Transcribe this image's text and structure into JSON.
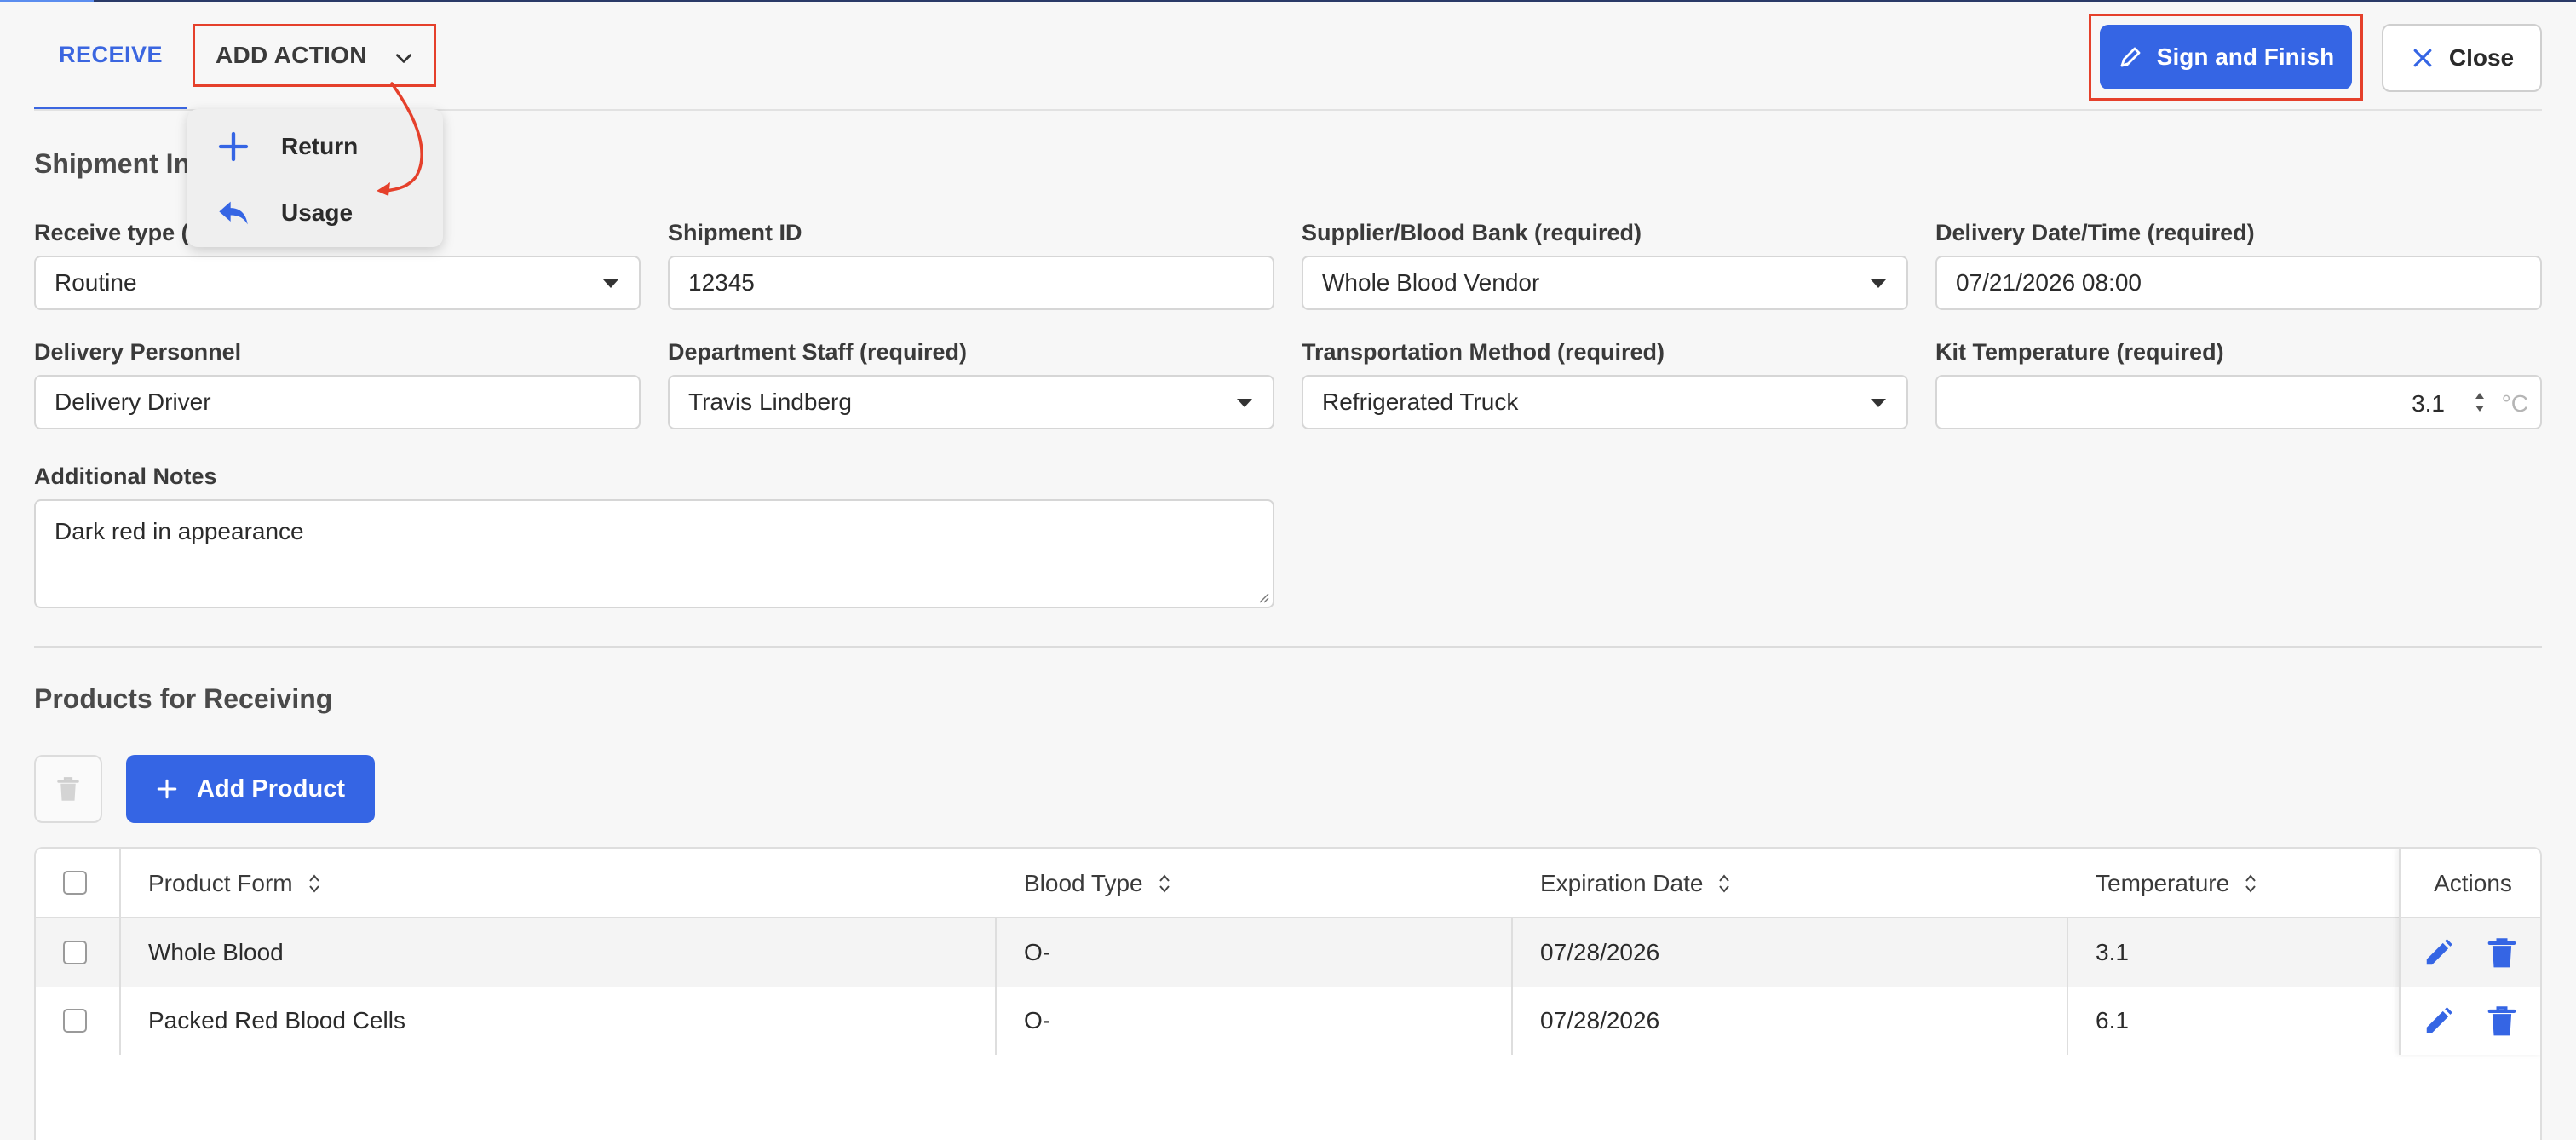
{
  "header": {
    "tab_receive": "RECEIVE",
    "add_action_label": "ADD ACTION",
    "sign_finish_label": "Sign and Finish",
    "close_label": "Close"
  },
  "menu": {
    "items": [
      {
        "label": "Return",
        "icon": "plus-icon"
      },
      {
        "label": "Usage",
        "icon": "reply-arrow-icon"
      }
    ]
  },
  "shipment": {
    "title_visible": "Shipment In",
    "receive_type": {
      "label_visible": "Receive type (r",
      "value": "Routine"
    },
    "shipment_id": {
      "label": "Shipment ID",
      "value": "12345"
    },
    "supplier": {
      "label": "Supplier/Blood Bank (required)",
      "value": "Whole Blood Vendor"
    },
    "delivery_date": {
      "label": "Delivery Date/Time (required)",
      "value": "07/21/2026 08:00"
    },
    "delivery_personnel": {
      "label": "Delivery Personnel",
      "value": "Delivery Driver"
    },
    "department_staff": {
      "label": "Department Staff (required)",
      "value": "Travis Lindberg"
    },
    "transport_method": {
      "label": "Transportation Method (required)",
      "value": "Refrigerated Truck"
    },
    "kit_temperature": {
      "label": "Kit Temperature (required)",
      "value": "3.1",
      "unit": "°C"
    },
    "notes": {
      "label": "Additional Notes",
      "value": "Dark red in appearance"
    }
  },
  "products": {
    "title": "Products for Receiving",
    "add_label": "Add Product",
    "columns": [
      "Product Form",
      "Blood Type",
      "Expiration Date",
      "Temperature",
      "Actions"
    ],
    "rows": [
      {
        "form": "Whole Blood",
        "blood_type": "O-",
        "expiration": "07/28/2026",
        "temperature": "3.1"
      },
      {
        "form": "Packed Red Blood Cells",
        "blood_type": "O-",
        "expiration": "07/28/2026",
        "temperature": "6.1"
      }
    ]
  },
  "colors": {
    "accent": "#3565e4",
    "highlight": "#e5402b"
  }
}
